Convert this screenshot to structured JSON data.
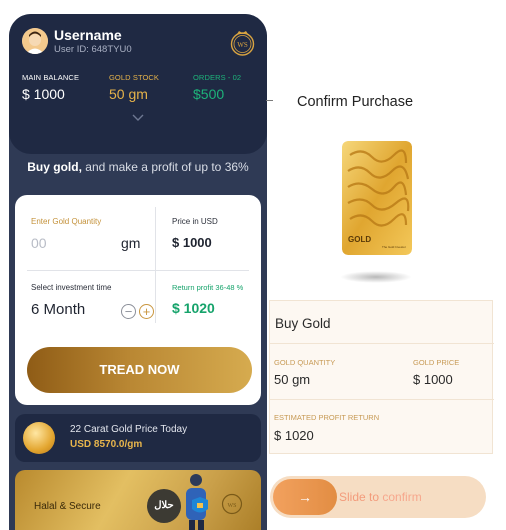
{
  "user": {
    "name": "Username",
    "id_text": "User ID: 648TYU0",
    "logo_text": "WS"
  },
  "balances": [
    {
      "label": "MAIN BALANCE",
      "value": "$ 1000",
      "label_color": "#ffffff",
      "value_color": "#ffffff"
    },
    {
      "label": "GOLD STOCK",
      "value": "50 gm",
      "label_color": "#e6b34a",
      "value_color": "#e6b34a"
    },
    {
      "label": "ORDERS - 02",
      "value": "$500",
      "label_color": "#1db37a",
      "value_color": "#1db37a"
    }
  ],
  "promo": {
    "strong": "Buy gold,",
    "rest": " and make a profit of up to 36%"
  },
  "purchase_card": {
    "qty_label": "Enter Gold Quantity",
    "qty_placeholder": "00",
    "qty_unit": "gm",
    "usd_label": "Price in USD",
    "usd_value": "$ 1000",
    "investment_label": "Select investment time",
    "investment_value": "6 Month",
    "minus": "−",
    "plus": "+",
    "return_label": "Return profit 36-48 %",
    "return_value": "$ 1020",
    "button": "TREAD NOW"
  },
  "gold_price": {
    "title": "22 Carat Gold Price Today",
    "price": "USD 8570.0/gm"
  },
  "halal": {
    "label": "Halal & Secure",
    "badge": "حلال",
    "logo_text": "WS"
  },
  "confirm": {
    "title": "Confirm Purchase",
    "bar_text": "GOLD",
    "bar_subtext": "The Gold Investor",
    "summary_title": "Buy Gold",
    "qty_label": "GOLD QUANTITY",
    "qty_value": "50 gm",
    "price_label": "GOLD PRICE",
    "price_value": "$ 1000",
    "profit_label": "ESTIMATED PROFIT RETURN",
    "profit_value": "$ 1020",
    "slide_arrow": "→",
    "slide_strong": "Slide to",
    "slide_rest": " confirm"
  }
}
